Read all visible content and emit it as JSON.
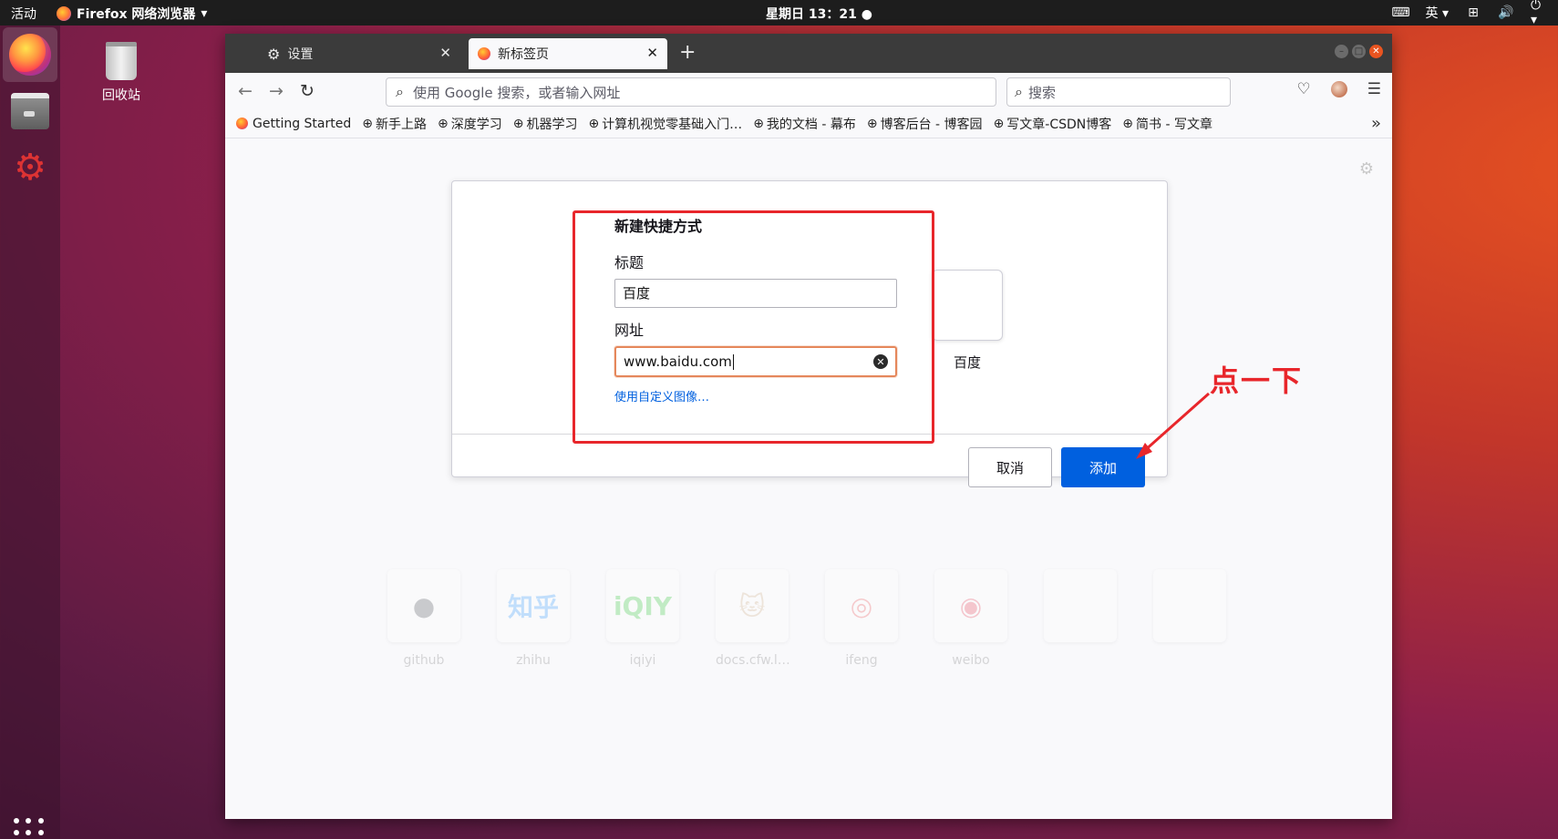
{
  "topbar": {
    "activities": "活动",
    "app_menu": "Firefox 网络浏览器",
    "clock": "星期日 13：21",
    "input_method": "英"
  },
  "desktop": {
    "trash_label": "回收站"
  },
  "browser": {
    "tabs": [
      {
        "label": "设置",
        "active": false
      },
      {
        "label": "新标签页",
        "active": true
      }
    ],
    "url_placeholder": "使用 Google 搜索，或者输入网址",
    "search_placeholder": "搜索",
    "bookmarks": [
      "Getting Started",
      "新手上路",
      "深度学习",
      "机器学习",
      "计算机视觉零基础入门…",
      "我的文档 - 幕布",
      "博客后台 - 博客园",
      "写文章-CSDN博客",
      "简书 - 写文章"
    ]
  },
  "dialog": {
    "title": "新建快捷方式",
    "title_label": "标题",
    "title_value": "百度",
    "url_label": "网址",
    "url_value": "www.baidu.com",
    "custom_image_link": "使用自定义图像…",
    "preview_label": "百度",
    "cancel_label": "取消",
    "add_label": "添加"
  },
  "top_sites": [
    {
      "label": "github",
      "symbol": "●",
      "color": "#24292e"
    },
    {
      "label": "zhihu",
      "symbol": "知乎",
      "color": "#0084ff"
    },
    {
      "label": "iqiyi",
      "symbol": "iQIY",
      "color": "#00be06"
    },
    {
      "label": "docs.cfw.l…",
      "symbol": "🐱",
      "color": "#c79b6b"
    },
    {
      "label": "ifeng",
      "symbol": "◎",
      "color": "#e8262b"
    },
    {
      "label": "weibo",
      "symbol": "◉",
      "color": "#e6162d"
    },
    {
      "label": "",
      "symbol": "",
      "color": "#ffffff"
    },
    {
      "label": "",
      "symbol": "",
      "color": "#ffffff"
    }
  ],
  "annotation": {
    "text": "点一下"
  },
  "colors": {
    "accent": "#0060df",
    "annotation_red": "#e8262b",
    "focus_ring": "#e5875b"
  }
}
